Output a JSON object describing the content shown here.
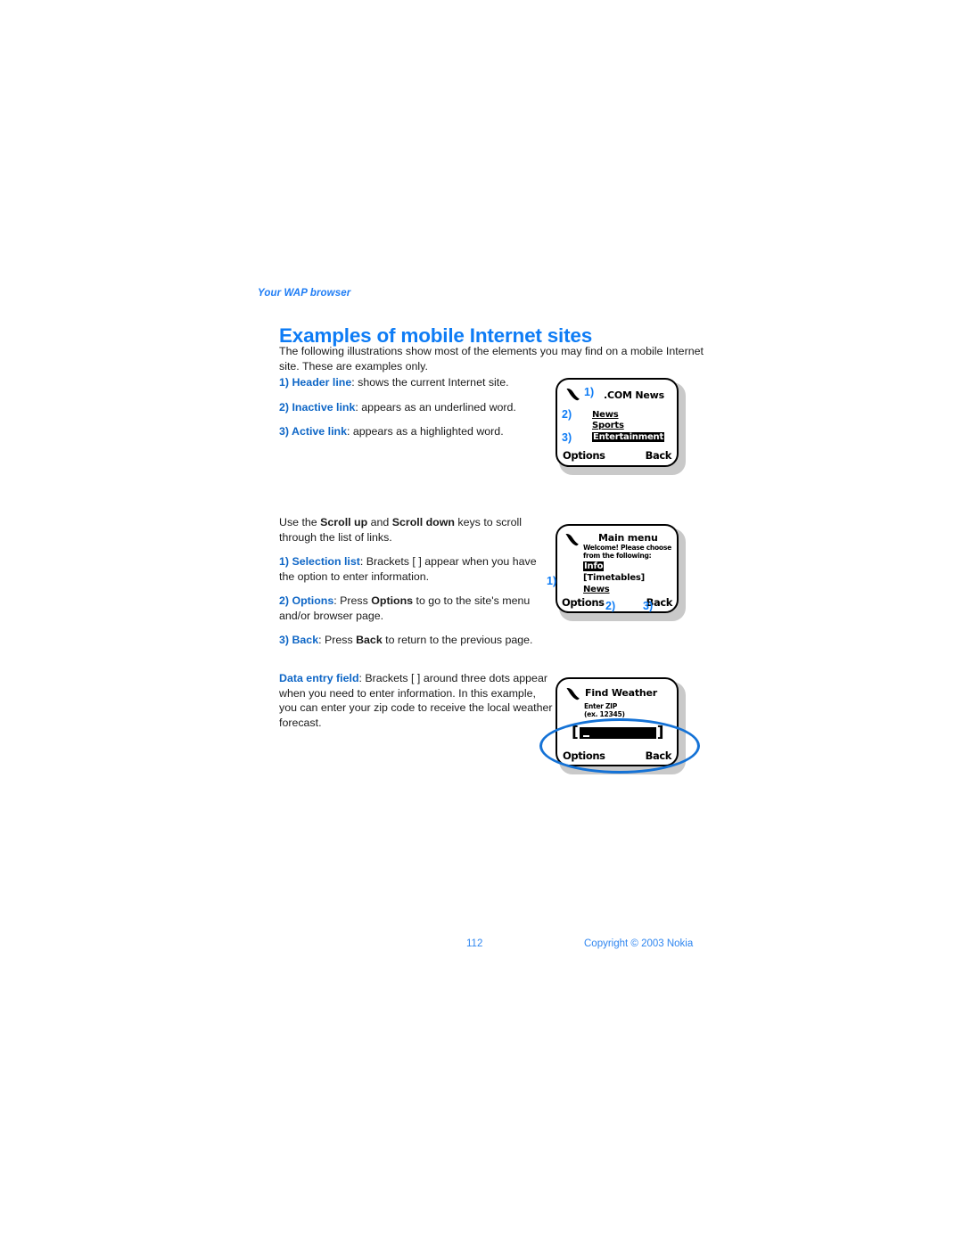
{
  "running_header": "Your WAP browser",
  "page_title": "Examples of mobile Internet sites",
  "intro": {
    "line1": "The following illustrations  show most of the elements you may find on a mobile",
    "line2": "Internet site. These are examples only."
  },
  "section1": {
    "items": [
      {
        "lead": "1) Header line",
        "rest": ": shows the current Internet site."
      },
      {
        "lead": "2) Inactive link",
        "rest": ": appears as an underlined word."
      },
      {
        "lead": "3) Active link",
        "rest": ": appears as a highlighted word."
      }
    ]
  },
  "section2": {
    "intro_a": "Use the ",
    "intro_b": "Scroll up",
    "intro_c": " and ",
    "intro_d": "Scroll down",
    "intro_e": " keys to scroll through the list of links.",
    "items": [
      {
        "lead": "1) Selection list",
        "rest": ": Brackets [ ] appear when you have the option to enter information."
      },
      {
        "lead": "2) Options",
        "rest_a": ": Press ",
        "rest_b": "Options",
        "rest_c": " to go to the site's menu and/or browser page."
      },
      {
        "lead": "3) Back",
        "rest_a": ": Press ",
        "rest_b": "Back",
        "rest_c": " to return to the previous page."
      }
    ]
  },
  "section3": {
    "lead": "Data entry field",
    "rest": ": Brackets [ ] around three dots appear when you need to enter information. In this example, you can enter your zip code to receive the local weather forecast."
  },
  "phone1": {
    "callout_header": "1)",
    "header": ".COM News",
    "callout_inactive": "2)",
    "link_news": "News",
    "link_sports": "Sports",
    "callout_active": "3)",
    "link_entertainment": "Entertainment",
    "softkey_left": "Options",
    "softkey_right": "Back",
    "icon": "handset-icon"
  },
  "phone2": {
    "header": "Main menu",
    "welcome": "Welcome! Please choose\nfrom the following:",
    "item_info": "Info",
    "callout_selection": "1)",
    "item_timetables": "[Timetables]",
    "item_news": "News",
    "softkey_left": "Options",
    "callout_options": "2)",
    "callout_back": "3)",
    "softkey_right": "Back",
    "icon": "handset-icon"
  },
  "phone3": {
    "header": "Find Weather",
    "prompt": "Enter ZIP\n(ex. 12345)",
    "bracket_open": "[",
    "bracket_close": "]",
    "softkey_left": "Options",
    "softkey_right": "Back",
    "icon": "handset-icon"
  },
  "footer": {
    "page_number": "112",
    "copyright": "Copyright © 2003 Nokia"
  },
  "colors": {
    "heading_blue": "#0e7cf5",
    "lead_blue": "#0e66c6",
    "footer_blue": "#2f86f0",
    "highlight_ellipse": "#1472d6"
  }
}
